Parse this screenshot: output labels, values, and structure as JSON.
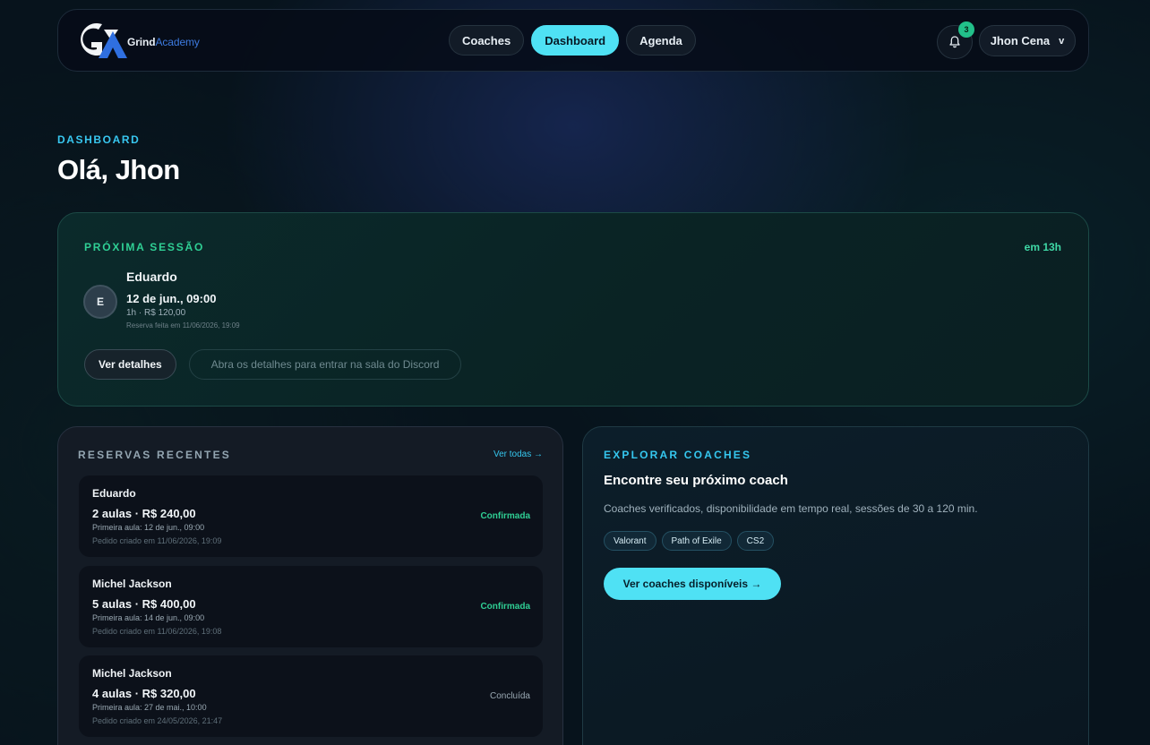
{
  "header": {
    "brand": {
      "name_bold": "Grind",
      "name_light": "Academy"
    },
    "nav": [
      {
        "label": "Coaches",
        "active": false
      },
      {
        "label": "Dashboard",
        "active": true
      },
      {
        "label": "Agenda",
        "active": false
      }
    ],
    "notifications": {
      "icon": "bell-icon",
      "count": "3"
    },
    "user": {
      "name": "Jhon Cena",
      "caret": "v"
    }
  },
  "page": {
    "eyebrow": "DASHBOARD",
    "greeting": "Olá, Jhon"
  },
  "next_session": {
    "label": "PRÓXIMA SESSÃO",
    "eta": "em 13h",
    "avatar_initial": "E",
    "coach": "Eduardo",
    "datetime": "12 de jun., 09:00",
    "meta": "1h · R$ 120,00",
    "booked_at": "Reserva feita em 11/06/2026, 19:09",
    "details_button": "Ver detalhes",
    "hint": "Abra os detalhes para entrar na sala do Discord"
  },
  "recent": {
    "label": "RESERVAS RECENTES",
    "see_all": "Ver todas →",
    "items": [
      {
        "coach": "Eduardo",
        "summary": "2 aulas · R$ 240,00",
        "first_class": "Primeira aula: 12 de jun., 09:00",
        "created": "Pedido criado em 11/06/2026, 19:09",
        "status": "Confirmada"
      },
      {
        "coach": "Michel Jackson",
        "summary": "5 aulas · R$ 400,00",
        "first_class": "Primeira aula: 14 de jun., 09:00",
        "created": "Pedido criado em 11/06/2026, 19:08",
        "status": "Confirmada"
      },
      {
        "coach": "Michel Jackson",
        "summary": "4 aulas · R$ 320,00",
        "first_class": "Primeira aula: 27 de mai., 10:00",
        "created": "Pedido criado em 24/05/2026, 21:47",
        "status": "Concluída"
      }
    ]
  },
  "explore": {
    "label": "EXPLORAR COACHES",
    "title": "Encontre seu próximo coach",
    "description": "Coaches verificados, disponibilidade em tempo real, sessões de 30 a 120 min.",
    "tags": [
      "Valorant",
      "Path of Exile",
      "CS2"
    ],
    "cta": "Ver coaches disponíveis →"
  },
  "colors": {
    "accent": "#4fe1f4",
    "success": "#2fcf94",
    "background": "#07131c"
  }
}
